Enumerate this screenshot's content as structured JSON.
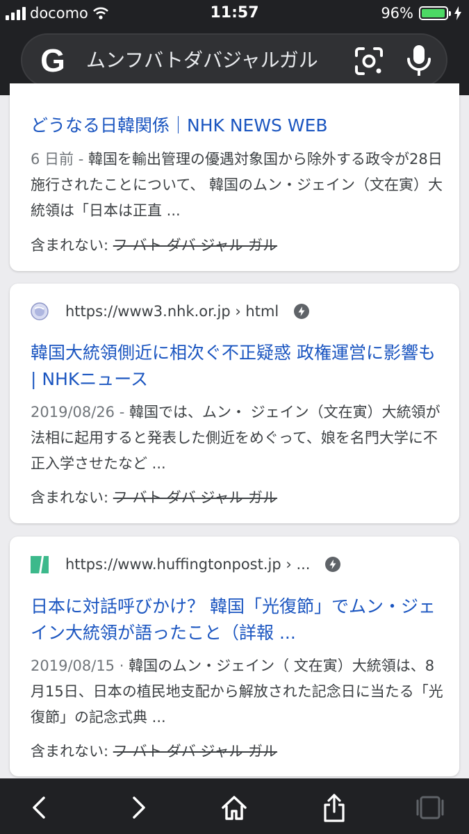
{
  "status_bar": {
    "carrier": "docomo",
    "time": "11:57",
    "battery_percent": "96%",
    "battery_level": 0.96,
    "battery_color": "#4cd964"
  },
  "search": {
    "query": "ムンフバトダバジャルガル",
    "logo_letter": "G",
    "lens_icon": "google-lens-icon",
    "mic_icon": "microphone-icon"
  },
  "results": [
    {
      "title": "どうなる日韓関係｜NHK NEWS WEB",
      "date": "6 日前",
      "separator": " - ",
      "snippet": "韓国を輸出管理の優遇対象国から除外する政令が28日施行されたことについて、 韓国のムン・ジェイン（文在寅）大統領は「日本は正直 ...",
      "missing_label": "含まれない: ",
      "missing_terms": "フ バト ダバ ジャル ガル"
    },
    {
      "url": "https://www3.nhk.or.jp › html",
      "favicon": "globe-icon",
      "amp": "amp-lightning-icon",
      "title": "韓国大統領側近に相次ぐ不正疑惑 政権運営に影響も | NHKニュース",
      "date": "2019/08/26",
      "separator": " - ",
      "snippet": "韓国では、ムン・ ジェイン（文在寅）大統領が法相に起用すると発表した側近をめぐって、娘を名門大学に不正入学させたなど ...",
      "missing_label": "含まれない: ",
      "missing_terms": "フ バト ダバ ジャル ガル"
    },
    {
      "url": "https://www.huffingtonpost.jp › ...",
      "favicon": "huffpost-icon",
      "amp": "amp-lightning-icon",
      "title": "日本に対話呼びかけ？ 韓国「光復節」でムン・ジェイン大統領が語ったこと（詳報 ...",
      "date": "2019/08/15",
      "separator": " · ",
      "snippet": "韓国のムン・ジェイン（ 文在寅）大統領は、8月15日、日本の植民地支配から解放された記念日に当たる「光復節」の記念式典 ...",
      "missing_label": "含まれない: ",
      "missing_terms": "フ バト ダバ ジャル ガル"
    }
  ],
  "toolbar": {
    "back": "chevron-left-icon",
    "forward": "chevron-right-icon",
    "home": "home-icon",
    "share": "share-icon",
    "tabs": "tabs-icon"
  },
  "colors": {
    "link": "#1a55c0",
    "chrome_bg": "#202124",
    "huffpost_green": "#3cb98b"
  }
}
